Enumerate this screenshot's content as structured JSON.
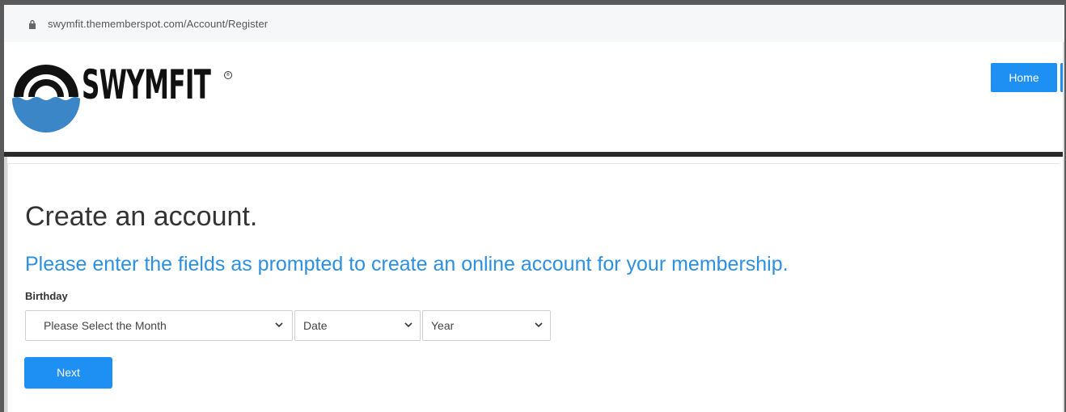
{
  "browser": {
    "url": "swymfit.thememberspot.com/Account/Register",
    "lock_icon": "lock-icon"
  },
  "header": {
    "brand": "SWYMFIT",
    "trademark": "®",
    "home_label": "Home"
  },
  "form": {
    "title": "Create an account.",
    "subtitle": "Please enter the fields as prompted to create an online account for your membership.",
    "birthday_label": "Birthday",
    "month_value": "Please Select the Month",
    "date_value": "Date",
    "year_value": "Year",
    "next_label": "Next"
  },
  "colors": {
    "accent": "#1e8ff3",
    "subtitle": "#2d8fe0",
    "logo_water": "#3a86c6",
    "divider": "#2a2a2a"
  }
}
